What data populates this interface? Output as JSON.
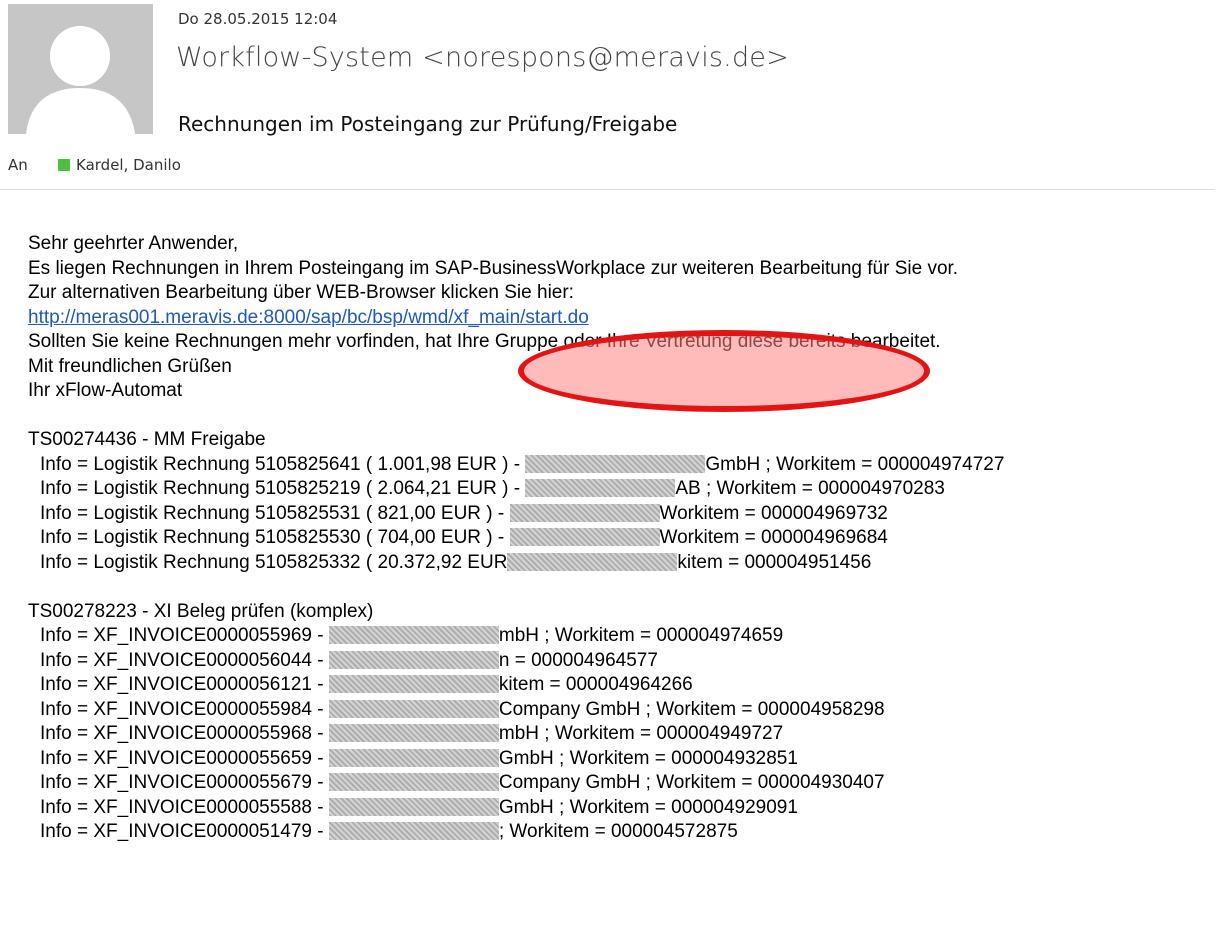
{
  "header": {
    "date": "Do 28.05.2015 12:04",
    "from": "Workflow-System <norespons@meravis.de>",
    "subject": "Rechnungen im Posteingang zur Prüfung/Freigabe",
    "to_label": "An",
    "recipient": "Kardel, Danilo"
  },
  "icons": {
    "avatar": "person-silhouette-icon",
    "presence": "presence-online-icon"
  },
  "colors": {
    "presence": "#4cc13f",
    "link": "#1f57c3",
    "highlight_border": "#e31414"
  },
  "body": {
    "greeting": "Sehr geehrter Anwender,",
    "line1": "Es liegen Rechnungen in Ihrem Posteingang im SAP-BusinessWorkplace zur weiteren Bearbeitung für Sie vor.",
    "line2": "Zur alternativen Bearbeitung über WEB-Browser klicken Sie hier:",
    "link": "http://meras001.meravis.de:8000/sap/bc/bsp/wmd/xf_main/start.do",
    "line3": "Sollten Sie keine Rechnungen mehr vorfinden, hat Ihre Gruppe oder Ihre Vertretung diese bereits bearbeitet.",
    "closing": "Mit freundlichen Grüßen",
    "signature": "Ihr xFlow-Automat"
  },
  "section1": {
    "title": "TS00274436 - MM Freigabe",
    "items": [
      {
        "pre": "Info = Logistik Rechnung 5105825641 ( 1.001,98 EUR ) - ",
        "post": "GmbH ; Workitem = 000004974727"
      },
      {
        "pre": "Info = Logistik Rechnung 5105825219 ( 2.064,21 EUR ) - ",
        "post": "AB ; Workitem = 000004970283"
      },
      {
        "pre": "Info = Logistik Rechnung 5105825531 ( 821,00 EUR ) - ",
        "post": "Workitem = 000004969732"
      },
      {
        "pre": "Info = Logistik Rechnung 5105825530 ( 704,00 EUR ) - ",
        "post": "Workitem = 000004969684"
      },
      {
        "pre": "Info = Logistik Rechnung 5105825332 ( 20.372,92 EUR",
        "post": "kitem = 000004951456"
      }
    ]
  },
  "section2": {
    "title": "TS00278223 - XI Beleg prüfen (komplex)",
    "items": [
      {
        "pre": "Info = XF_INVOICE0000055969 - ",
        "post": "mbH ; Workitem = 000004974659"
      },
      {
        "pre": "Info = XF_INVOICE0000056044 - ",
        "post": "n = 000004964577"
      },
      {
        "pre": "Info = XF_INVOICE0000056121 - ",
        "post": "kitem = 000004964266"
      },
      {
        "pre": "Info = XF_INVOICE0000055984 - ",
        "post": "Company GmbH ; Workitem = 000004958298"
      },
      {
        "pre": "Info = XF_INVOICE0000055968 - ",
        "post": "mbH ; Workitem = 000004949727"
      },
      {
        "pre": "Info = XF_INVOICE0000055659 - ",
        "post": "GmbH ; Workitem = 000004932851"
      },
      {
        "pre": "Info = XF_INVOICE0000055679 - ",
        "post": "Company GmbH ; Workitem = 000004930407"
      },
      {
        "pre": "Info = XF_INVOICE0000055588 - ",
        "post": "GmbH ; Workitem = 000004929091"
      },
      {
        "pre": "Info = XF_INVOICE0000051479 - ",
        "post": "; Workitem = 000004572875"
      }
    ]
  }
}
